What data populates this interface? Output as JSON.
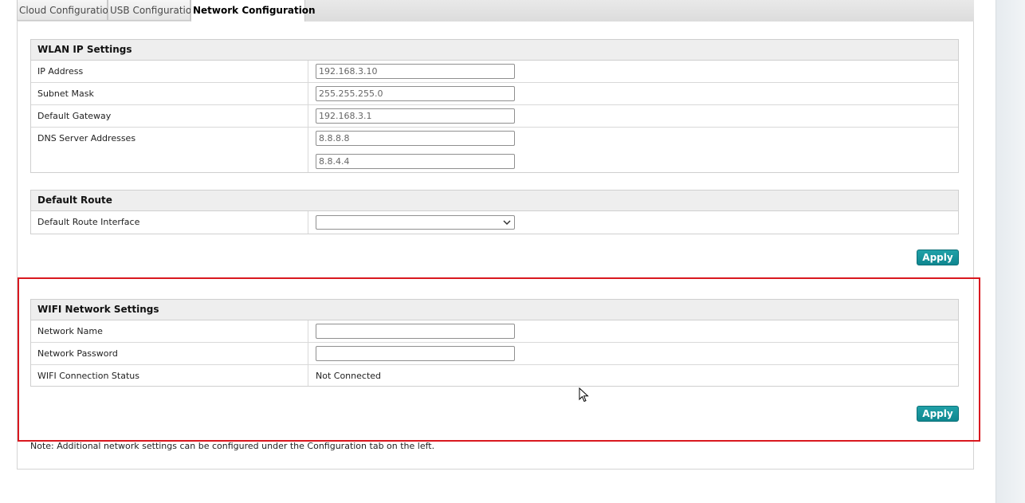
{
  "tabs": [
    {
      "label": "Cloud Configuration",
      "active": false
    },
    {
      "label": "USB Configuration",
      "active": false
    },
    {
      "label": "Network Configuration",
      "active": true
    }
  ],
  "wlan_ip_settings": {
    "title": "WLAN IP Settings",
    "ip_address": {
      "label": "IP Address",
      "value": "192.168.3.10"
    },
    "subnet_mask": {
      "label": "Subnet Mask",
      "value": "255.255.255.0"
    },
    "default_gateway": {
      "label": "Default Gateway",
      "value": "192.168.3.1"
    },
    "dns_servers": {
      "label": "DNS Server Addresses",
      "primary": "8.8.8.8",
      "secondary": "8.8.4.4"
    }
  },
  "default_route": {
    "title": "Default Route",
    "interface": {
      "label": "Default Route Interface",
      "value": ""
    }
  },
  "wifi_network_settings": {
    "title": "WIFI Network Settings",
    "network_name": {
      "label": "Network Name",
      "value": ""
    },
    "network_password": {
      "label": "Network Password",
      "value": ""
    },
    "connection_status": {
      "label": "WIFI Connection Status",
      "value": "Not Connected"
    }
  },
  "buttons": {
    "apply_label": "Apply"
  },
  "note": "Note: Additional network settings can be configured under the Configuration tab on the left.",
  "colors": {
    "accent": "#138b93",
    "highlight": "#d9181f",
    "header_bg": "#eeeeee"
  }
}
